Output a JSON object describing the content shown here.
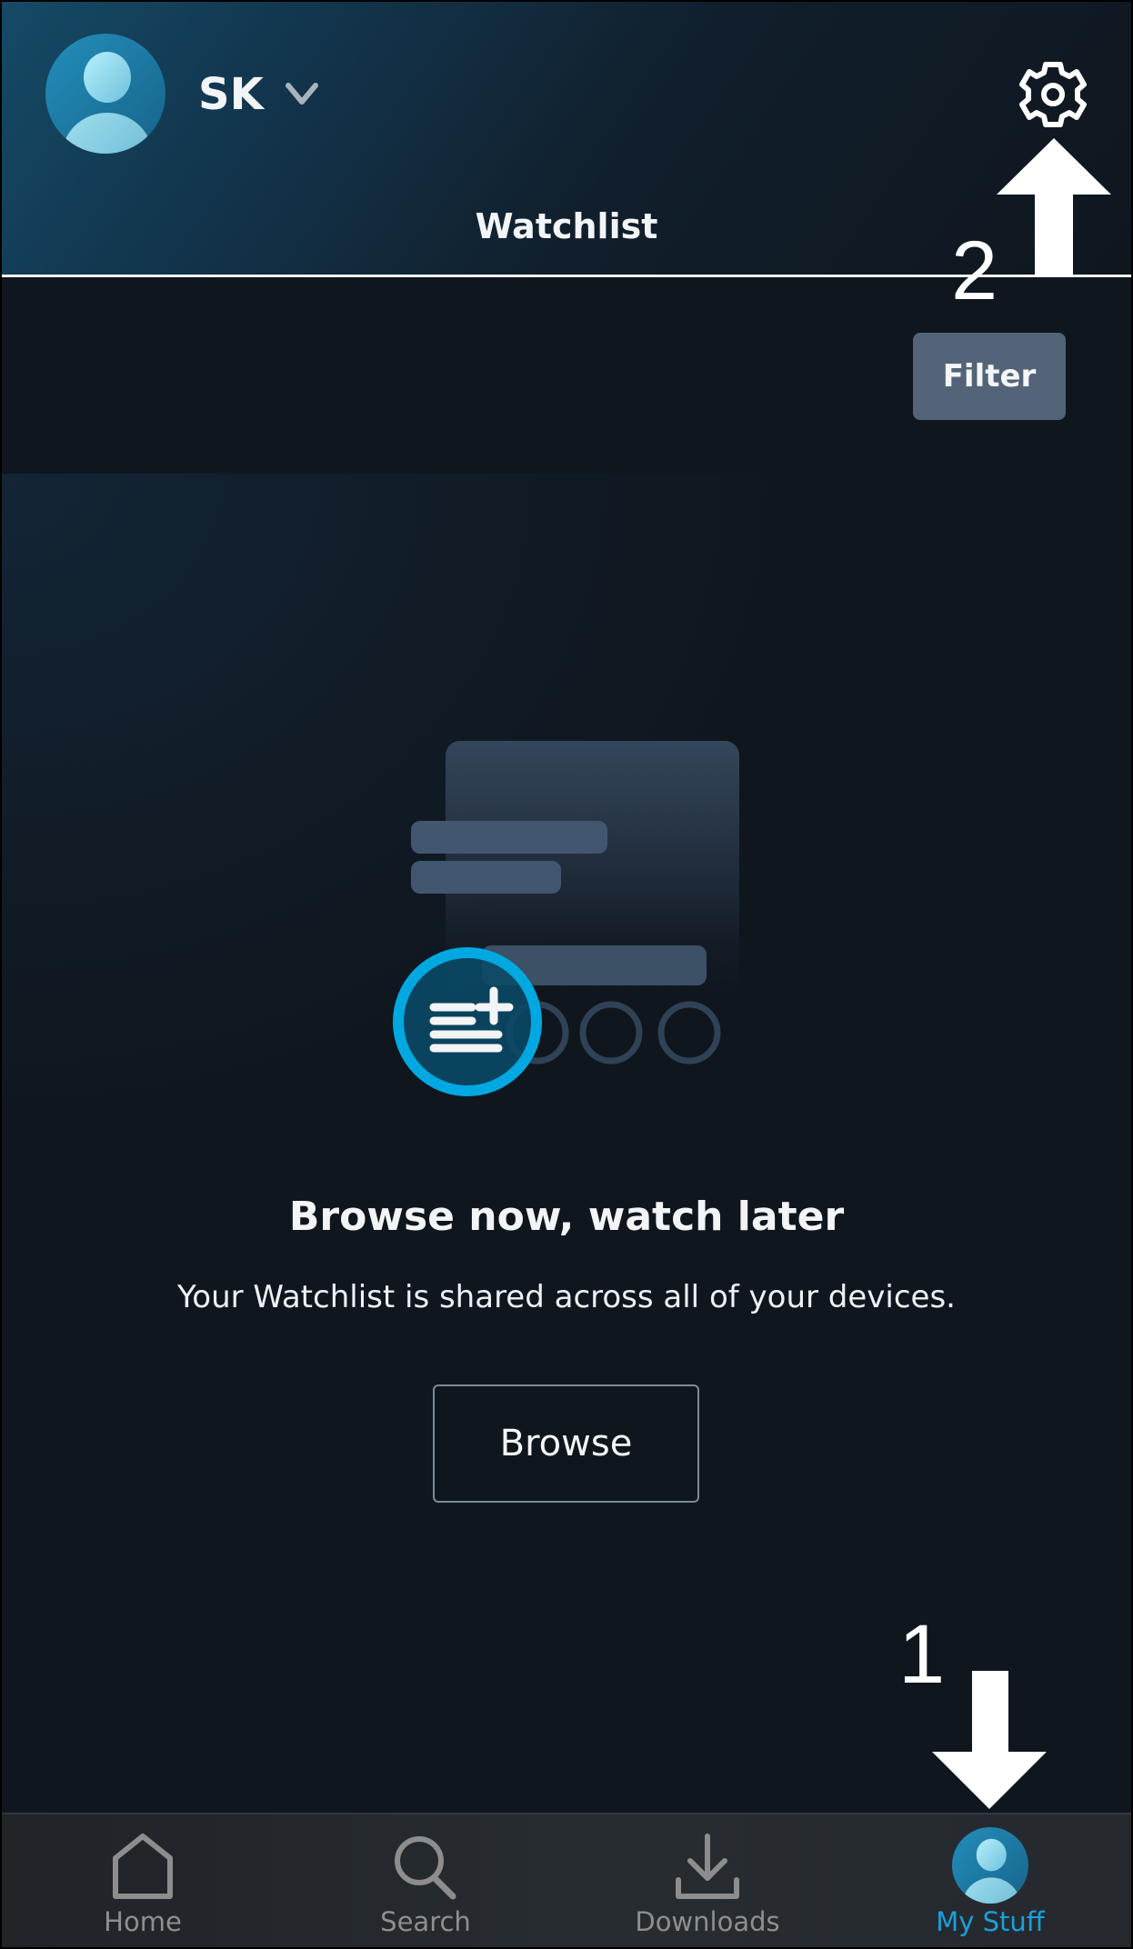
{
  "header": {
    "profile_name": "SK",
    "title": "Watchlist",
    "icons": {
      "avatar": "profile-avatar-icon",
      "chevron": "chevron-down-icon",
      "settings": "gear-icon"
    }
  },
  "toolbar": {
    "filter_label": "Filter"
  },
  "empty_state": {
    "illustration": "watchlist-add-icon",
    "title": "Browse now, watch later",
    "description": "Your Watchlist is shared across all of your devices.",
    "browse_label": "Browse"
  },
  "bottom_nav": {
    "items": [
      {
        "label": "Home",
        "icon": "home-icon",
        "active": false
      },
      {
        "label": "Search",
        "icon": "search-icon",
        "active": false
      },
      {
        "label": "Downloads",
        "icon": "download-icon",
        "active": false
      },
      {
        "label": "My Stuff",
        "icon": "profile-avatar-icon",
        "active": true
      }
    ]
  },
  "annotations": [
    {
      "number": "1",
      "arrow": "down",
      "target": "My Stuff"
    },
    {
      "number": "2",
      "arrow": "up",
      "target": "settings"
    }
  ],
  "colors": {
    "accent": "#00a8e1",
    "active_nav": "#1aa0db",
    "filter_button": "#536478",
    "background": "#0f161e"
  }
}
